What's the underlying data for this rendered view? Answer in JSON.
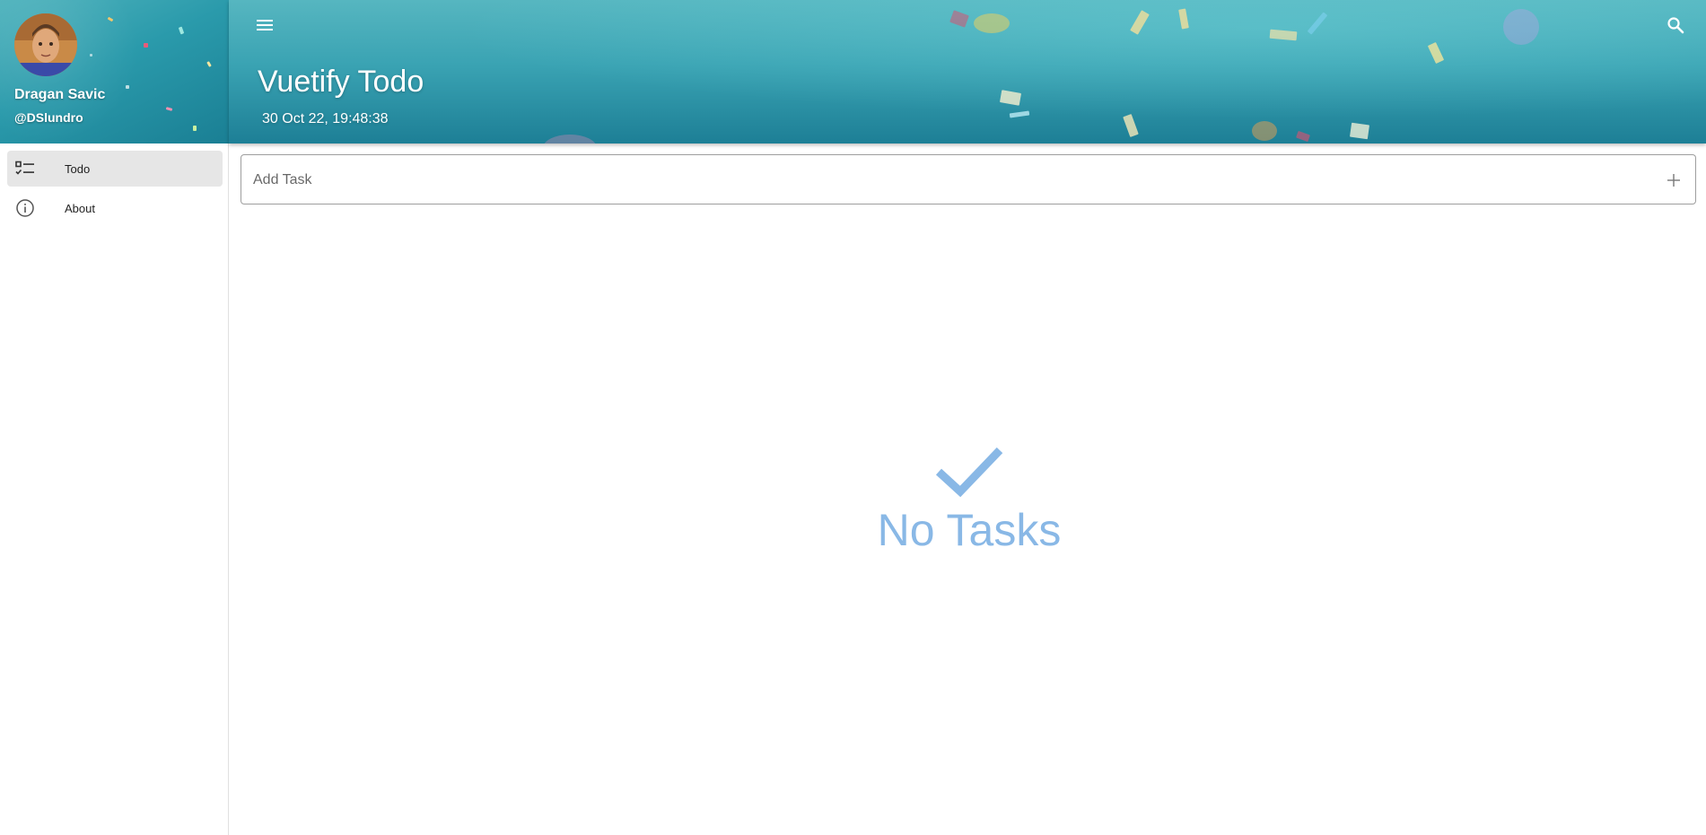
{
  "colors": {
    "accent_teal": "#2a9aab",
    "empty_state_blue": "#89b8e6",
    "active_nav_bg": "#e6e6e6"
  },
  "sidebar": {
    "user": {
      "name": "Dragan Savic",
      "handle": "@DSlundro",
      "avatar_icon": "avatar"
    },
    "items": [
      {
        "label": "Todo",
        "icon": "checklist-icon",
        "active": true
      },
      {
        "label": "About",
        "icon": "info-icon",
        "active": false
      }
    ]
  },
  "appbar": {
    "title": "Vuetify Todo",
    "datetime": "30 Oct 22, 19:48:38",
    "menu_icon": "menu-icon",
    "search_icon": "search-icon"
  },
  "add_task": {
    "placeholder": "Add Task",
    "value": "",
    "add_icon": "plus-icon"
  },
  "empty_state": {
    "icon": "check-icon",
    "text": "No Tasks"
  }
}
